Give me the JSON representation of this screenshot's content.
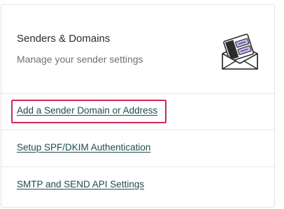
{
  "panel": {
    "title": "Senders & Domains",
    "subtitle": "Manage your sender settings",
    "illustration_icon": "envelope-with-letter-icon"
  },
  "links": [
    {
      "label": "Add a Sender Domain or Address",
      "focused": true
    },
    {
      "label": "Setup SPF/DKIM Authentication",
      "focused": false
    },
    {
      "label": "SMTP and SEND API Settings",
      "focused": false
    }
  ],
  "colors": {
    "focus_outline": "#d1285a",
    "link_text": "#1e4b4b",
    "illustration_accent": "#c9b6f2"
  }
}
